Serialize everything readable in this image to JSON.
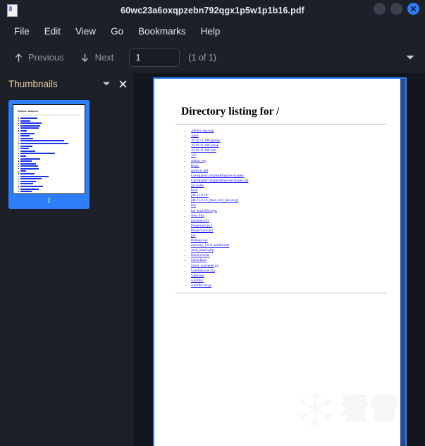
{
  "window": {
    "title": "60wc23a6oxqpzebn792qgx1p5w1p1b16.pdf",
    "app_icon": "document-page-icon",
    "controls": {
      "minimize": "minimize-button",
      "maximize": "maximize-button",
      "close": "close-button"
    },
    "accent_color": "#2d7ff9",
    "background_color": "#1d2029"
  },
  "menubar": {
    "items": [
      {
        "label": "File"
      },
      {
        "label": "Edit"
      },
      {
        "label": "View"
      },
      {
        "label": "Go"
      },
      {
        "label": "Bookmarks"
      },
      {
        "label": "Help"
      }
    ]
  },
  "toolbar": {
    "previous_label": "Previous",
    "next_label": "Next",
    "page_value": "1",
    "page_placeholder": "1",
    "page_count": "(1 of 1)",
    "overflow_icon": "chevron-down-icon"
  },
  "sidebar": {
    "title": "Thumbnails",
    "title_color": "#e6cf9f",
    "dropdown_icon": "chevron-down-icon",
    "close_icon": "close-icon",
    "thumbnails": [
      {
        "page_number": "1",
        "selected": true,
        "preview_title": "Directory listing for /"
      }
    ]
  },
  "document": {
    "heading": "Directory listing for /",
    "entries": [
      {
        "name": ".admin_reg.swp"
      },
      {
        "name": ".keys"
      },
      {
        "name": "10.10.11.186.gnmap"
      },
      {
        "name": "10.10.11.186.nmap"
      },
      {
        "name": "10.10.11.186.xml"
      },
      {
        "name": "123"
      },
      {
        "name": "admin_reg"
      },
      {
        "name": "Bugs/"
      },
      {
        "name": "darkvnc.dtd"
      },
      {
        "name": "GhostpackCompiledBinaries-master/"
      },
      {
        "name": "GhostpackCompiledBinaries-master.zip"
      },
      {
        "name": "goo.john"
      },
      {
        "name": "hash"
      },
      {
        "name": "jdk-11.0.10/"
      },
      {
        "name": "jdk-11.0.10_linux-x64_bin.tar.gz"
      },
      {
        "name": "key"
      },
      {
        "name": "lab_bm1189.ovpn"
      },
      {
        "name": "New File"
      },
      {
        "name": "payload.wav"
      },
      {
        "name": "Powermad.ps1"
      },
      {
        "name": "PowerView.ps1"
      },
      {
        "name": "pre"
      },
      {
        "name": "Rubeus.exe"
      },
      {
        "name": "rustscan_1.8.0_amd64.deb"
      },
      {
        "name": "send_email.php"
      },
      {
        "name": "ticket.ccache"
      },
      {
        "name": "ticket.kirbi"
      },
      {
        "name": "ticket_converter.py"
      },
      {
        "name": "UserInfo.exe.zip"
      },
      {
        "name": "wget-log"
      },
      {
        "name": "wordlist/"
      },
      {
        "name": "wordlist.tar.gz"
      }
    ],
    "link_color": "#2020ee"
  },
  "watermark": {
    "text": "看雪",
    "icon": "snowflake-icon"
  }
}
